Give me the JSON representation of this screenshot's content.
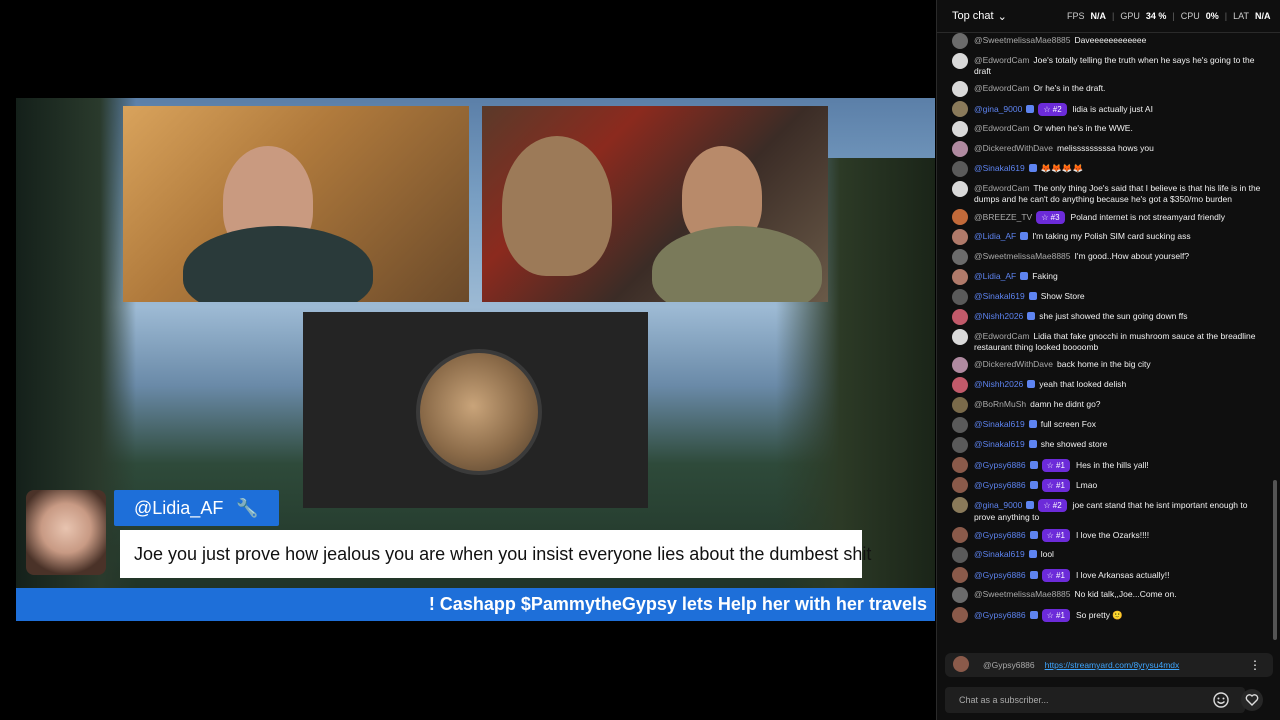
{
  "video": {
    "comment": {
      "username": "@Lidia_AF",
      "text": "Joe you just prove how jealous you are when you insist everyone lies about the dumbest shit"
    },
    "ticker": "! Cashapp $PammytheGypsy lets Help her with her travels"
  },
  "chat": {
    "header": {
      "top_chat_label": "Top chat",
      "fps_label": "FPS",
      "fps_value": "N/A",
      "gpu_label": "GPU",
      "gpu_value": "34 %",
      "cpu_label": "CPU",
      "cpu_value": "0%",
      "lat_label": "LAT",
      "lat_value": "N/A"
    },
    "messages": [
      {
        "author": "@SweetmelissaMae8885",
        "text": "Daveeeeeeeeeeee",
        "avatar_color": "#6b6b6b",
        "author_style": ""
      },
      {
        "author": "@EdwordCam",
        "text": "Joe's totally telling the truth when he says he's going to the draft",
        "avatar_color": "#d9d9d9",
        "author_style": ""
      },
      {
        "author": "@EdwordCam",
        "text": "Or he's in the draft.",
        "avatar_color": "#d9d9d9",
        "author_style": ""
      },
      {
        "author": "@gina_9000",
        "rank": "#2",
        "text": "lidia is actually just AI",
        "avatar_color": "#8a7a5a",
        "author_style": "mod"
      },
      {
        "author": "@EdwordCam",
        "text": "Or when he's in the WWE.",
        "avatar_color": "#d9d9d9",
        "author_style": ""
      },
      {
        "author": "@DickeredWithDave",
        "text": "melisssssssssa hows you",
        "avatar_color": "#b08aa0",
        "author_style": ""
      },
      {
        "author": "@Sinakal619",
        "text": "🦊🦊🦊🦊",
        "avatar_color": "#5a5a5a",
        "author_style": "mod"
      },
      {
        "author": "@EdwordCam",
        "text": "The only thing Joe's said that I believe is that his life is in the dumps and he can't do anything because he's got a $350/mo burden",
        "avatar_color": "#d9d9d9",
        "author_style": ""
      },
      {
        "author": "@BREEZE_TV",
        "rank": "#3",
        "text": "Poland internet is not streamyard friendly",
        "avatar_color": "#c26a3a",
        "author_style": ""
      },
      {
        "author": "@Lidia_AF",
        "text": "I'm taking my Polish SIM card sucking ass",
        "avatar_color": "#b07a6a",
        "author_style": "mod"
      },
      {
        "author": "@SweetmelissaMae8885",
        "text": "I'm good..How about yourself?",
        "avatar_color": "#6b6b6b",
        "author_style": ""
      },
      {
        "author": "@Lidia_AF",
        "text": "Faking",
        "avatar_color": "#b07a6a",
        "author_style": "mod"
      },
      {
        "author": "@Sinakal619",
        "text": "Show Store",
        "avatar_color": "#5a5a5a",
        "author_style": "mod"
      },
      {
        "author": "@Nishh2026",
        "text": "she just showed the sun going down ffs",
        "avatar_color": "#c25a6a",
        "author_style": "mod"
      },
      {
        "author": "@EdwordCam",
        "text": "Lidia that fake gnocchi in mushroom sauce at the breadline restaurant thing looked boooomb",
        "avatar_color": "#d9d9d9",
        "author_style": ""
      },
      {
        "author": "@DickeredWithDave",
        "text": "back home in the big city",
        "avatar_color": "#b08aa0",
        "author_style": ""
      },
      {
        "author": "@Nishh2026",
        "text": "yeah that looked delish",
        "avatar_color": "#c25a6a",
        "author_style": "mod"
      },
      {
        "author": "@BoRnMuSh",
        "text": "damn he didnt go?",
        "avatar_color": "#7a6a4a",
        "author_style": ""
      },
      {
        "author": "@Sinakal619",
        "text": "full screen Fox",
        "avatar_color": "#5a5a5a",
        "author_style": "mod"
      },
      {
        "author": "@Sinakal619",
        "text": "she showed store",
        "avatar_color": "#5a5a5a",
        "author_style": "mod"
      },
      {
        "author": "@Gypsy6886",
        "rank": "#1",
        "text": "Hes in the hills yall!",
        "avatar_color": "#8a5a4a",
        "author_style": "mod"
      },
      {
        "author": "@Gypsy6886",
        "rank": "#1",
        "text": "Lmao",
        "avatar_color": "#8a5a4a",
        "author_style": "mod"
      },
      {
        "author": "@gina_9000",
        "rank": "#2",
        "text": "joe cant stand that he isnt important enough to prove anything to",
        "avatar_color": "#8a7a5a",
        "author_style": "mod"
      },
      {
        "author": "@Gypsy6886",
        "rank": "#1",
        "text": "I love the Ozarks!!!!",
        "avatar_color": "#8a5a4a",
        "author_style": "mod"
      },
      {
        "author": "@Sinakal619",
        "text": "lool",
        "avatar_color": "#5a5a5a",
        "author_style": "mod"
      },
      {
        "author": "@Gypsy6886",
        "rank": "#1",
        "text": "I love Arkansas actually!!",
        "avatar_color": "#8a5a4a",
        "author_style": "mod"
      },
      {
        "author": "@SweetmelissaMae8885",
        "text": "No kid talk,,Joe...Come on.",
        "avatar_color": "#6b6b6b",
        "author_style": ""
      },
      {
        "author": "@Gypsy6886",
        "rank": "#1",
        "text": "So pretty 🙂",
        "avatar_color": "#8a5a4a",
        "author_style": "mod"
      }
    ],
    "pinned": {
      "author": "@Gypsy6886",
      "link": "https://streamyard.com/8yrysu4mdx"
    },
    "input_placeholder": "Chat as a subscriber..."
  }
}
